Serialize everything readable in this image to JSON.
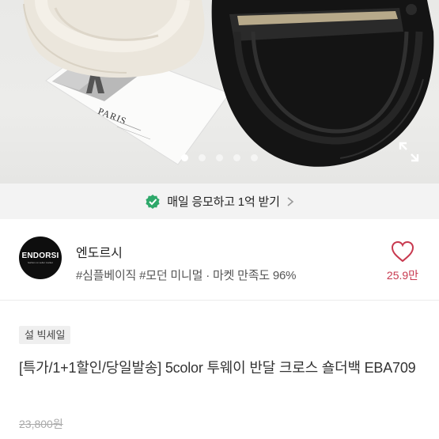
{
  "hero": {
    "postcard_text": "PARIS",
    "slide_count": 5,
    "active_slide": 1
  },
  "banner": {
    "text": "매일 응모하고 1억 받기",
    "accent_color": "#2ea86a"
  },
  "shop": {
    "logo_text": "ENDORSI",
    "logo_subtext": "fashion on seller market",
    "name": "엔도르시",
    "tags": "#심플베이직 #모던 미니멀 · 마켓 만족도 96%",
    "like_count": "25.9만",
    "like_color": "#c8394f"
  },
  "product": {
    "badge": "설 빅세일",
    "title": "[특가/1+1할인/당일발송] 5color 투웨이 반달 크로스 숄더백 EBA709",
    "original_price": "23,800원"
  }
}
